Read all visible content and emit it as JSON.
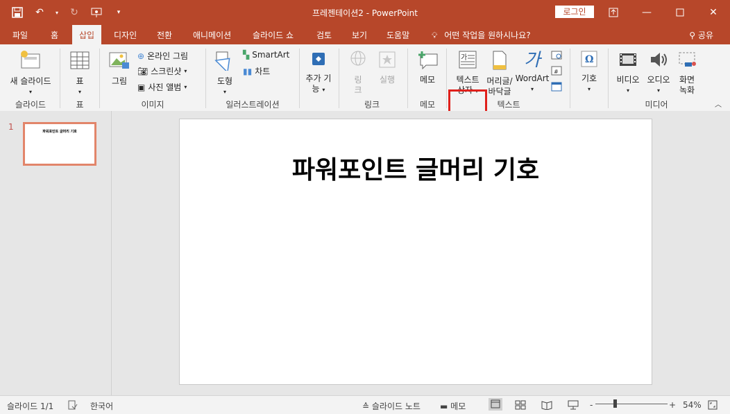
{
  "window": {
    "doc_title": "프레젠테이션2",
    "title_separator": "-",
    "app_name": "PowerPoint",
    "login_label": "로그인"
  },
  "tabs": [
    "파일",
    "홈",
    "삽입",
    "디자인",
    "전환",
    "애니메이션",
    "슬라이드 쇼",
    "검토",
    "보기",
    "도움말"
  ],
  "active_tab": "삽입",
  "tell_me": "어떤 작업을 원하시나요?",
  "share_label": "공유",
  "ribbon": {
    "new_slide": "새 슬라이드",
    "slides_group": "슬라이드",
    "table": "표",
    "tables_group": "표",
    "picture": "그림",
    "online_pictures": "온라인 그림",
    "screenshot": "스크린샷",
    "photo_album": "사진 앨범",
    "images_group": "이미지",
    "shapes": "도형",
    "smartart": "SmartArt",
    "chart": "차트",
    "illustrations_group": "일러스트레이션",
    "addins_line1": "추가 기",
    "addins_line2": "능",
    "link_line1": "링",
    "link_line2": "크",
    "action": "실행",
    "links_group": "링크",
    "comment": "메모",
    "comments_group": "메모",
    "textbox_line1": "텍스트",
    "textbox_line2": "상자",
    "header_line1": "머리글/",
    "header_line2": "바닥글",
    "wordart": "WordArt",
    "text_group": "텍스트",
    "symbols": "기호",
    "video": "비디오",
    "audio": "오디오",
    "screenrec_line1": "화면",
    "screenrec_line2": "녹화",
    "media_group": "미디어"
  },
  "slides_panel": {
    "number": "1",
    "thumb_title": "파워포인트 글머리 기호"
  },
  "slide": {
    "title": "파워포인트 글머리 기호"
  },
  "statusbar": {
    "slide_count": "슬라이드 1/1",
    "language": "한국어",
    "notes": "슬라이드 노트",
    "comments": "메모",
    "zoom": "54%",
    "zoom_minus": "-",
    "zoom_plus": "+"
  },
  "colors": {
    "accent": "#b7472a",
    "highlight": "#e0201b"
  }
}
